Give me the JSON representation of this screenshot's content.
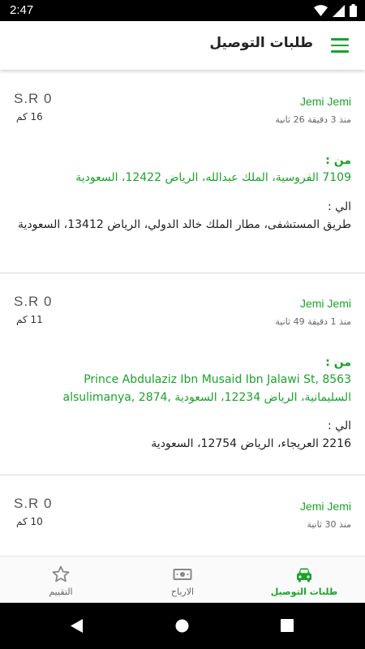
{
  "status_bar": {
    "time": "2:47"
  },
  "app_bar": {
    "title": "طلبات التوصيل"
  },
  "orders": [
    {
      "customer": "Jemi Jemi",
      "elapsed": "منذ 3 دقيقة 26 ثانية",
      "price": "S.R 0",
      "distance": "16 كم",
      "from_label": "من :",
      "from_address": "7109 الفروسية، الملك عبدالله، الرياض 12422، السعودية",
      "to_label": "الي :",
      "to_address": "طريق المستشفى، مطار الملك خالد الدولي، الرياض 13412، السعودية"
    },
    {
      "customer": "Jemi Jemi",
      "elapsed": "منذ 1 دقيقة 49 ثانية",
      "price": "S.R 0",
      "distance": "11 كم",
      "from_label": "من :",
      "from_address_line1": "Prince Abdulaziz Ibn Musaid Ibn Jalawi St, 8563",
      "from_address_line2": "السليمانية، الرياض 12234، السعودية ,alsulimanya, 2874",
      "to_label": "الي :",
      "to_address": "2216 العريجاء، الرياض 12754، السعودية"
    },
    {
      "customer": "Jemi Jemi",
      "elapsed": "منذ 30 ثانية",
      "price": "S.R 0",
      "distance": "10 كم"
    }
  ],
  "bottom_nav": {
    "delivery_requests": "طلبات التوصيل",
    "earnings": "الارباح",
    "rating": "التقييم"
  },
  "colors": {
    "accent": "#1aa32a",
    "text": "#222222",
    "muted": "#666666"
  }
}
